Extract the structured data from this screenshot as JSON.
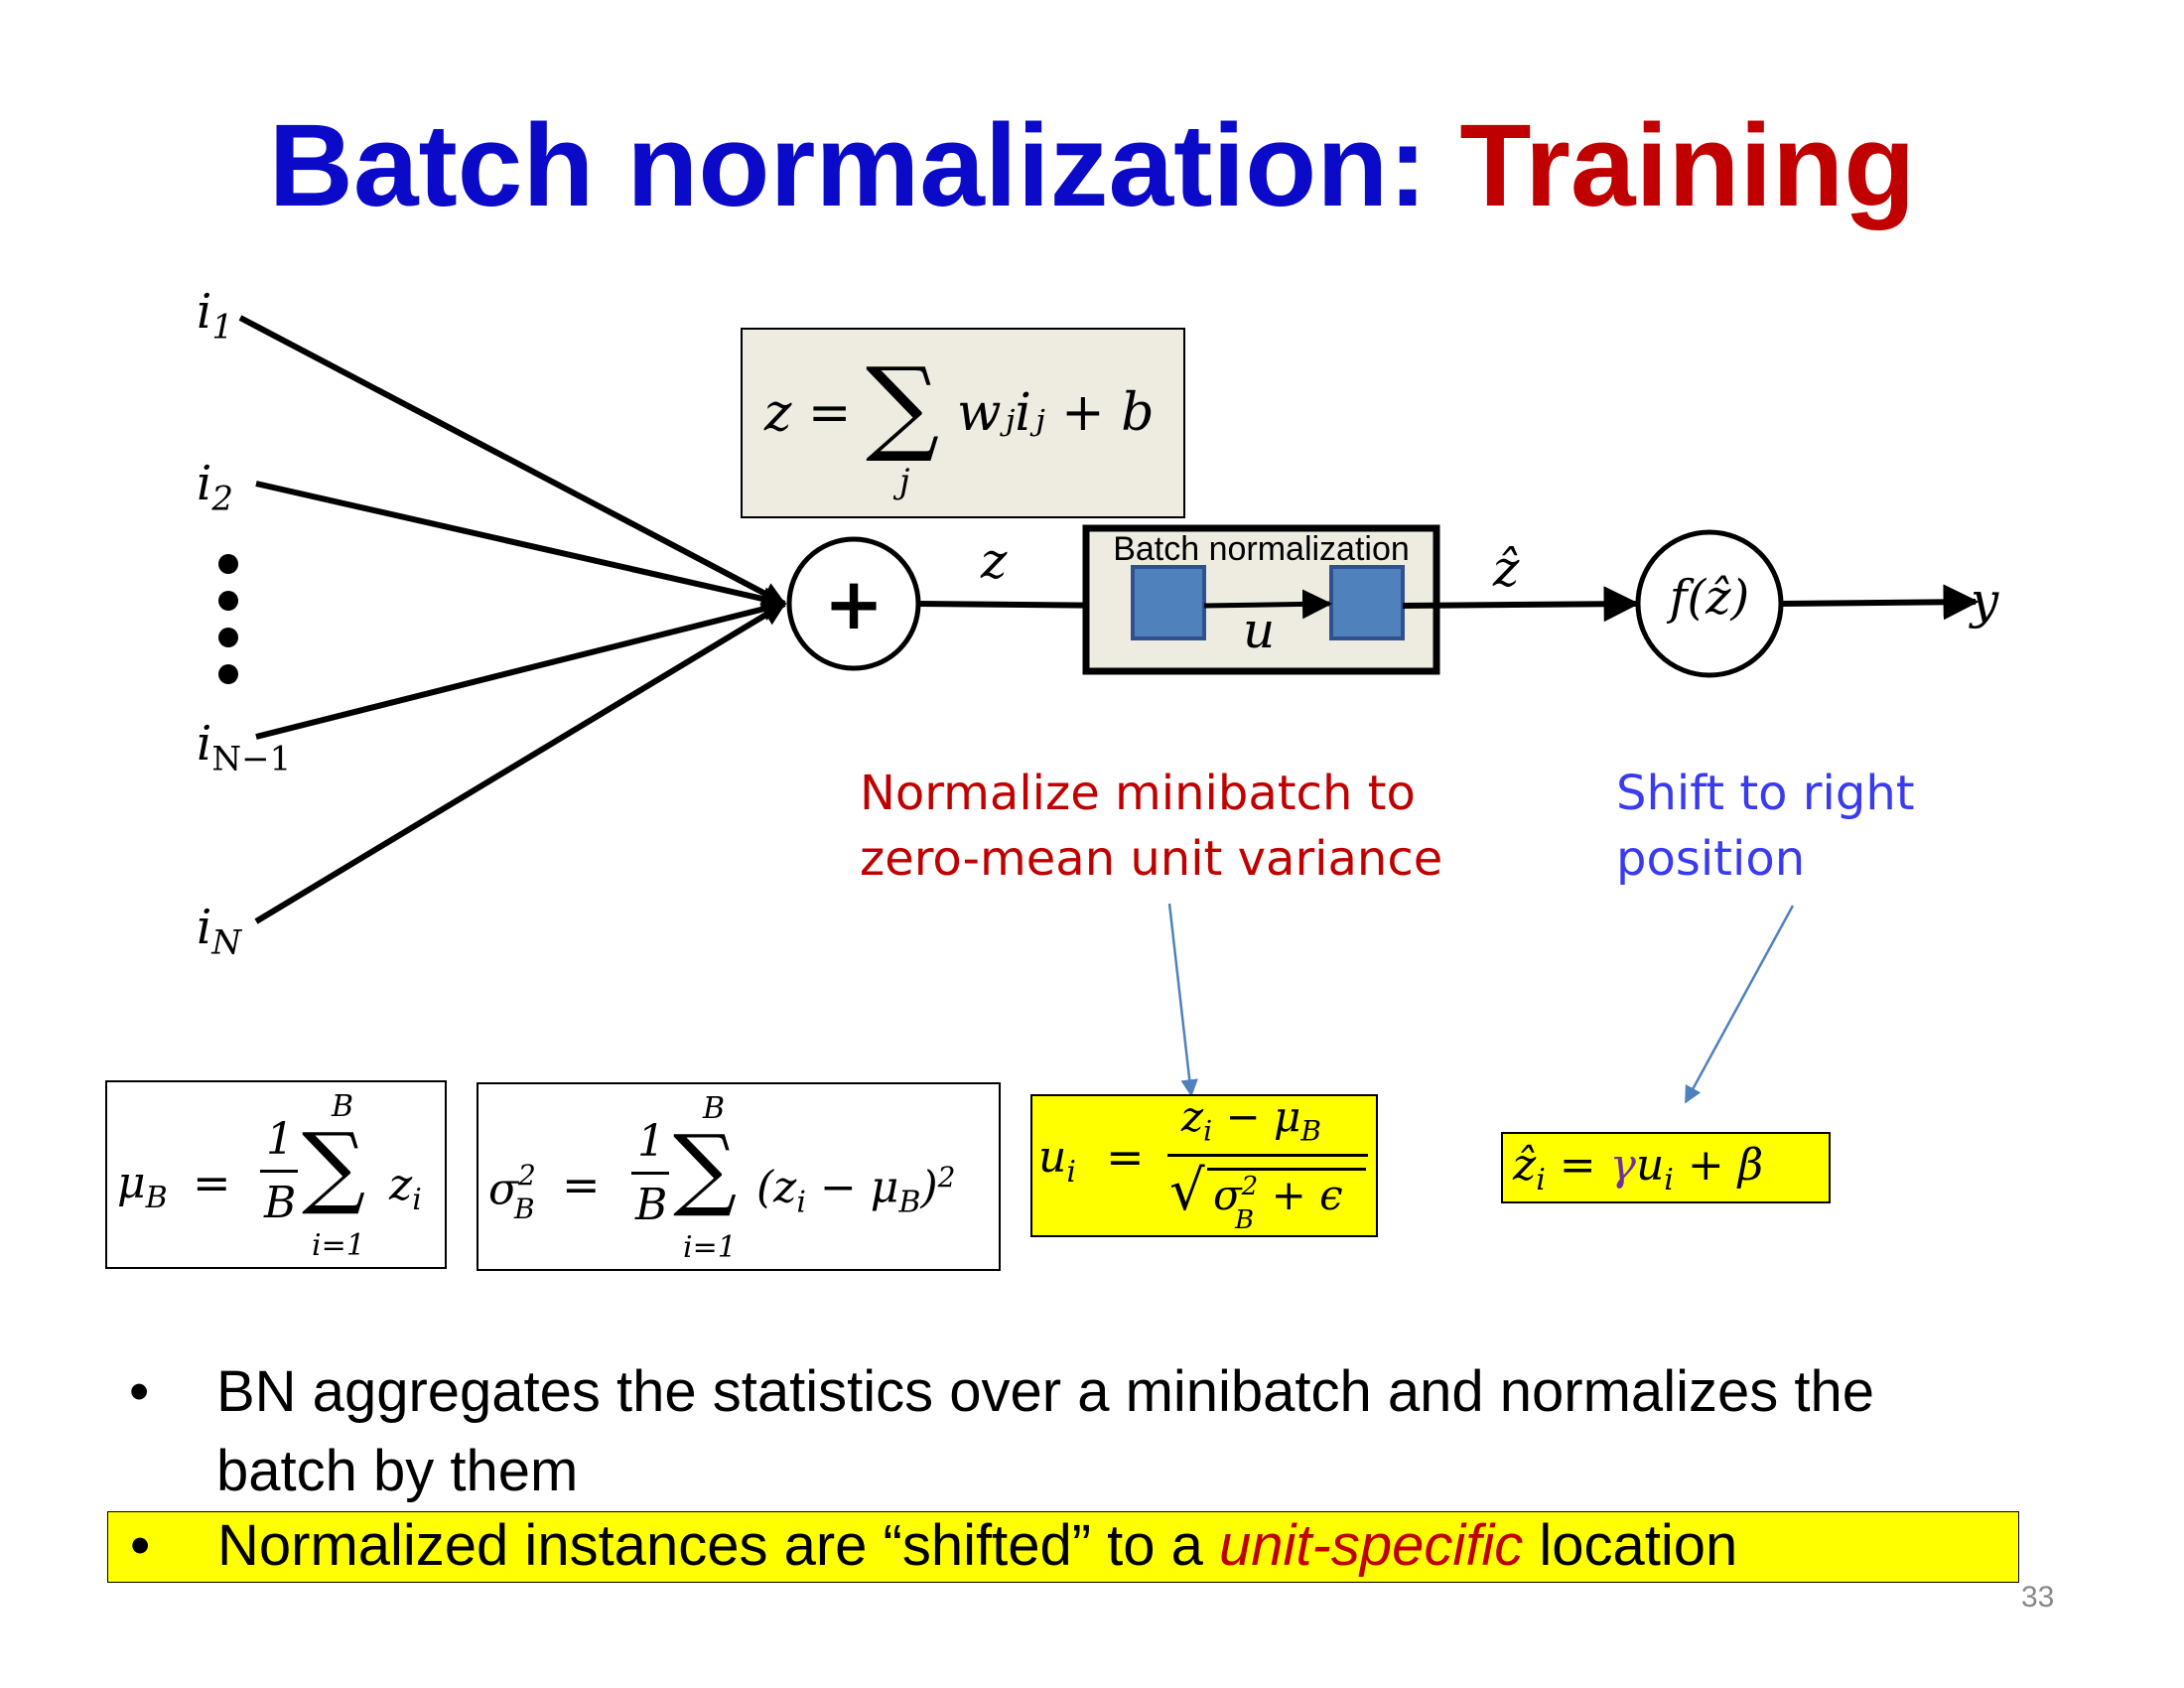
{
  "slide": {
    "title_part1": "Batch normalization: ",
    "title_part2": "Training",
    "page_number": "33",
    "colors": {
      "title_blue": "#0a0ac8",
      "title_red": "#c00000",
      "note_red": "#c00000",
      "note_blue": "#3a3af0",
      "highlight": "#ffff00",
      "block_blue": "#4f81bd",
      "arrow_blue": "#4f81bd",
      "bn_box_fill": "#eeece1"
    }
  },
  "network": {
    "inputs": [
      {
        "base": "i",
        "sub": "1"
      },
      {
        "base": "i",
        "sub": "2"
      },
      {
        "base": "i",
        "sub": "N−1"
      },
      {
        "base": "i",
        "sub": "N"
      }
    ],
    "sum_symbol": "+",
    "z_label": "z",
    "u_label": "u",
    "zhat_label": "ẑ",
    "activation": "f(ẑ)",
    "output_label": "y",
    "bn_box_label": "Batch normalization"
  },
  "sum_equation": {
    "lhs": "z = ",
    "sum_symbol": "∑",
    "sum_index": "j",
    "rhs": "wⱼiⱼ + b"
  },
  "notes": {
    "normalize": [
      "Normalize minibatch to",
      "zero-mean unit variance"
    ],
    "shift": [
      "Shift to right",
      "position"
    ]
  },
  "formulas": {
    "mean": {
      "lhs": "μ",
      "lhs_sub": "B",
      "eq": "=",
      "num": "1",
      "den": "B",
      "sum": "∑",
      "upper": "B",
      "lower": "i=1",
      "term": "z",
      "term_sub": "i"
    },
    "variance": {
      "lhs": "σ",
      "lhs_sup": "2",
      "lhs_sub": "B",
      "eq": "=",
      "num": "1",
      "den": "B",
      "sum": "∑",
      "upper": "B",
      "lower": "i=1",
      "term": "(z",
      "term_sub": "i",
      "term_rest": " − μ",
      "term_rest_sub": "B",
      "term_close": ")",
      "term_sup": "2"
    },
    "normalize": {
      "lhs": "u",
      "lhs_sub": "i",
      "eq": "=",
      "num": "z",
      "num_sub": "i",
      "num_rest": " − μ",
      "num_rest_sub": "B",
      "den_sigma": "σ",
      "den_sup": "2",
      "den_sub": "B",
      "den_rest": " + ϵ"
    },
    "shift": {
      "lhs": "ẑ",
      "lhs_sub": "i",
      "eq": " = ",
      "gamma": "γ",
      "u": "u",
      "u_sub": "i",
      "rest": " + β"
    }
  },
  "bullets": {
    "first": "BN aggregates the statistics over a minibatch and normalizes the batch by them",
    "second_before": "Normalized instances are “shifted” to a ",
    "second_emph": "unit-specific",
    "second_after": " location",
    "marker": "•"
  }
}
